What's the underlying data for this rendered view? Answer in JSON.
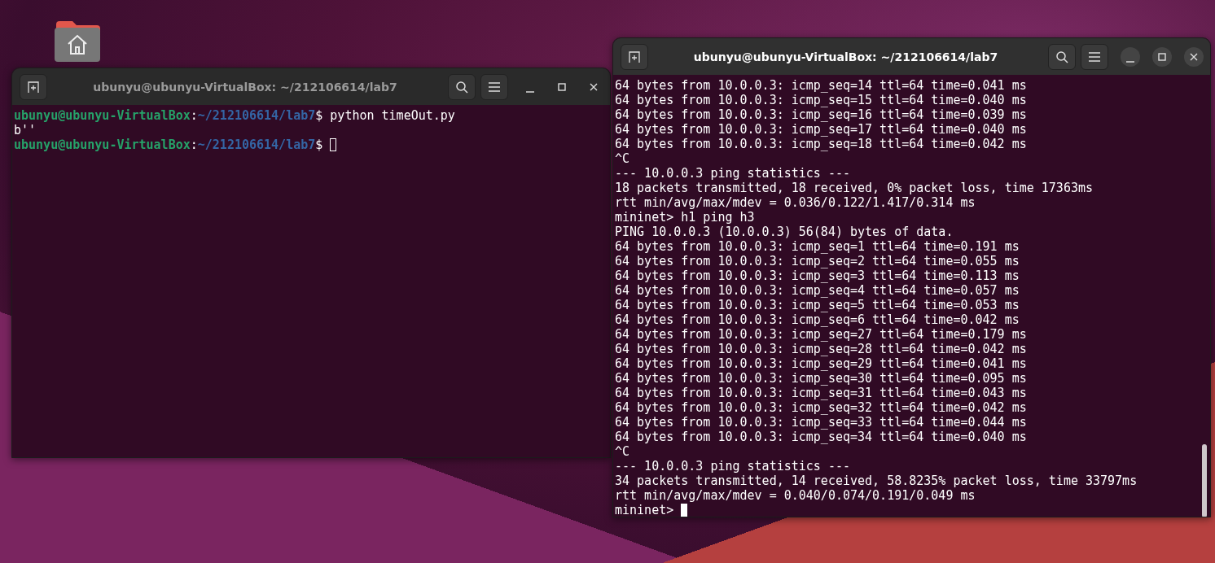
{
  "desktop": {
    "icons": [
      {
        "kind": "home-folder"
      }
    ]
  },
  "terminals": [
    {
      "title": "ubunyu@ubunyu-VirtualBox: ~/212106614/lab7",
      "focused": false,
      "lines": [
        {
          "kind": "prompt",
          "user": "ubunyu@ubunyu-VirtualBox",
          "sep": ":",
          "path": "~/212106614/lab7",
          "dollar": "$",
          "command": " python timeOut.py",
          "cursor": false
        },
        {
          "kind": "output",
          "text": "b''",
          "cursor": false
        },
        {
          "kind": "prompt",
          "user": "ubunyu@ubunyu-VirtualBox",
          "sep": ":",
          "path": "~/212106614/lab7",
          "dollar": "$",
          "cursor": true
        }
      ]
    },
    {
      "title": "ubunyu@ubunyu-VirtualBox: ~/212106614/lab7",
      "focused": true,
      "lines": [
        {
          "kind": "output",
          "text": "64 bytes from 10.0.0.3: icmp_seq=14 ttl=64 time=0.041 ms",
          "cursor": false
        },
        {
          "kind": "output",
          "text": "64 bytes from 10.0.0.3: icmp_seq=15 ttl=64 time=0.040 ms",
          "cursor": false
        },
        {
          "kind": "output",
          "text": "64 bytes from 10.0.0.3: icmp_seq=16 ttl=64 time=0.039 ms",
          "cursor": false
        },
        {
          "kind": "output",
          "text": "64 bytes from 10.0.0.3: icmp_seq=17 ttl=64 time=0.040 ms",
          "cursor": false
        },
        {
          "kind": "output",
          "text": "64 bytes from 10.0.0.3: icmp_seq=18 ttl=64 time=0.042 ms",
          "cursor": false
        },
        {
          "kind": "output",
          "text": "^C",
          "cursor": false
        },
        {
          "kind": "output",
          "text": "--- 10.0.0.3 ping statistics ---",
          "cursor": false
        },
        {
          "kind": "output",
          "text": "18 packets transmitted, 18 received, 0% packet loss, time 17363ms",
          "cursor": false
        },
        {
          "kind": "output",
          "text": "rtt min/avg/max/mdev = 0.036/0.122/1.417/0.314 ms",
          "cursor": false
        },
        {
          "kind": "output",
          "text": "mininet> h1 ping h3",
          "cursor": false
        },
        {
          "kind": "output",
          "text": "PING 10.0.0.3 (10.0.0.3) 56(84) bytes of data.",
          "cursor": false
        },
        {
          "kind": "output",
          "text": "64 bytes from 10.0.0.3: icmp_seq=1 ttl=64 time=0.191 ms",
          "cursor": false
        },
        {
          "kind": "output",
          "text": "64 bytes from 10.0.0.3: icmp_seq=2 ttl=64 time=0.055 ms",
          "cursor": false
        },
        {
          "kind": "output",
          "text": "64 bytes from 10.0.0.3: icmp_seq=3 ttl=64 time=0.113 ms",
          "cursor": false
        },
        {
          "kind": "output",
          "text": "64 bytes from 10.0.0.3: icmp_seq=4 ttl=64 time=0.057 ms",
          "cursor": false
        },
        {
          "kind": "output",
          "text": "64 bytes from 10.0.0.3: icmp_seq=5 ttl=64 time=0.053 ms",
          "cursor": false
        },
        {
          "kind": "output",
          "text": "64 bytes from 10.0.0.3: icmp_seq=6 ttl=64 time=0.042 ms",
          "cursor": false
        },
        {
          "kind": "output",
          "text": "64 bytes from 10.0.0.3: icmp_seq=27 ttl=64 time=0.179 ms",
          "cursor": false
        },
        {
          "kind": "output",
          "text": "64 bytes from 10.0.0.3: icmp_seq=28 ttl=64 time=0.042 ms",
          "cursor": false
        },
        {
          "kind": "output",
          "text": "64 bytes from 10.0.0.3: icmp_seq=29 ttl=64 time=0.041 ms",
          "cursor": false
        },
        {
          "kind": "output",
          "text": "64 bytes from 10.0.0.3: icmp_seq=30 ttl=64 time=0.095 ms",
          "cursor": false
        },
        {
          "kind": "output",
          "text": "64 bytes from 10.0.0.3: icmp_seq=31 ttl=64 time=0.043 ms",
          "cursor": false
        },
        {
          "kind": "output",
          "text": "64 bytes from 10.0.0.3: icmp_seq=32 ttl=64 time=0.042 ms",
          "cursor": false
        },
        {
          "kind": "output",
          "text": "64 bytes from 10.0.0.3: icmp_seq=33 ttl=64 time=0.044 ms",
          "cursor": false
        },
        {
          "kind": "output",
          "text": "64 bytes from 10.0.0.3: icmp_seq=34 ttl=64 time=0.040 ms",
          "cursor": false
        },
        {
          "kind": "output",
          "text": "^C",
          "cursor": false
        },
        {
          "kind": "output",
          "text": "--- 10.0.0.3 ping statistics ---",
          "cursor": false
        },
        {
          "kind": "output",
          "text": "34 packets transmitted, 14 received, 58.8235% packet loss, time 33797ms",
          "cursor": false
        },
        {
          "kind": "output",
          "text": "rtt min/avg/max/mdev = 0.040/0.074/0.191/0.049 ms",
          "cursor": false
        },
        {
          "kind": "output",
          "text": "mininet> ",
          "cursor": true
        }
      ]
    }
  ]
}
